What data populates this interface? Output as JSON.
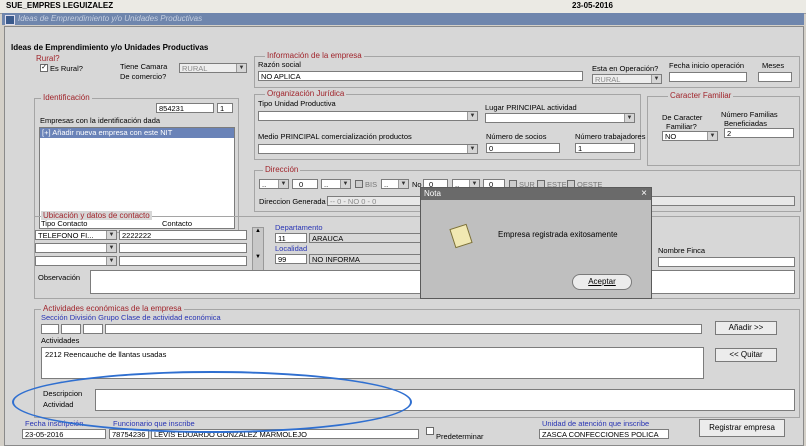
{
  "topbar": {
    "left": "SUE_EMPRES  LEGUIZALEZ",
    "right": "23-05-2016"
  },
  "window": {
    "title": "Ideas de Emprendimiento y/o Unidades Productivas"
  },
  "form": {
    "heading": "Ideas de Emprendimiento y/o Unidades Productivas",
    "rural": {
      "legend": "Rural?",
      "checkbox_label": "Es Rural?",
      "checked": "✓",
      "camara_label_1": "Tiene Camara",
      "camara_label_2": "De comercio?",
      "camara_value": "RURAL"
    },
    "empresa": {
      "legend": "Información de la empresa",
      "razon_label": "Razón social",
      "razon_value": "NO APLICA",
      "operacion_label": "Esta en Operación?",
      "operacion_value": "RURAL",
      "fecha_inicio_label": "Fecha inicio operación",
      "meses_label": "Meses"
    },
    "identificacion": {
      "legend": "Identificación",
      "nit": "854231",
      "dv": "1",
      "empresas_label": "Empresas con la identificación dada",
      "add_item": "[+] Añadir nueva empresa con este NIT"
    },
    "juridica": {
      "legend": "Organización Jurídica",
      "tipo_label": "Tipo Unidad Productiva",
      "lugar_label": "Lugar PRINCIPAL actividad",
      "medio_label": "Medio PRINCIPAL comercialización productos",
      "socios_label": "Número de socios",
      "socios_value": "0",
      "trabajadores_label": "Número trabajadores",
      "trabajadores_value": "1"
    },
    "familiar": {
      "legend": "Caracter Familiar",
      "caracter_label_1": "De Caracter",
      "caracter_label_2": "Familiar?",
      "caracter_value": "NO",
      "familias_label_1": "Número Familias",
      "familias_label_2": "Beneficiadas",
      "familias_value": "2"
    },
    "direccion": {
      "legend": "Dirección",
      "bis": "BIS",
      "no": "No",
      "sur": "SUR",
      "este": "ESTE",
      "oeste": "OESTE",
      "generada_label": "Direccion Generada",
      "generada_value": "-- 0 - NO 0 - 0",
      "f1": "0",
      "f2": "0",
      "f3": "0"
    },
    "ubicacion": {
      "legend": "Ubicación y datos de contacto",
      "tipo_label": "Tipo Contacto",
      "contacto_label": "Contacto",
      "tipo_value": "TELEFONO FI...",
      "contacto_value": "2222222",
      "depto_label": "Departamento",
      "depto_code": "11",
      "depto_name": "ARAUCA",
      "localidad_label": "Localidad",
      "localidad_code": "99",
      "localidad_name": "NO INFORMA",
      "finca_label": "Nombre Finca",
      "observacion_label": "Observación"
    },
    "actividades": {
      "legend": "Actividades económicas de la empresa",
      "header": "Sección División Grupo  Clase de actividad económica",
      "actividades_label": "Actividades",
      "actividad_value": "2212 Reencauche de llantas usadas",
      "add_button": "Añadir >>",
      "remove_button": "<< Quitar",
      "descripcion_label_1": "Descripcion",
      "descripcion_label_2": "Actividad"
    },
    "footer": {
      "fecha_label": "Fecha inscripción",
      "funcionario_label": "Funcionario que inscribe",
      "fecha_value": "23-05-2016",
      "funcionario_id": "78754236",
      "funcionario_name": "LEVIS EDUARDO GONZALEZ MARMOLEJO",
      "predeterminar_label": "Predeterminar",
      "unidad_label": "Unidad de atención que inscribe",
      "unidad_value": "ZASCA CONFECCIONES POLICA",
      "registrar_button": "Registrar empresa"
    }
  },
  "dialog": {
    "title": "Nota",
    "message": "Empresa registrada exitosamente",
    "accept_button": "Aceptar",
    "close_symbol": "×",
    "icon": "note-icon"
  },
  "colors": {
    "legend": "#a0242b",
    "title_bar": "#6f86ad",
    "highlight_oval": "#2f6fd0",
    "link_blue": "#2834b4"
  }
}
